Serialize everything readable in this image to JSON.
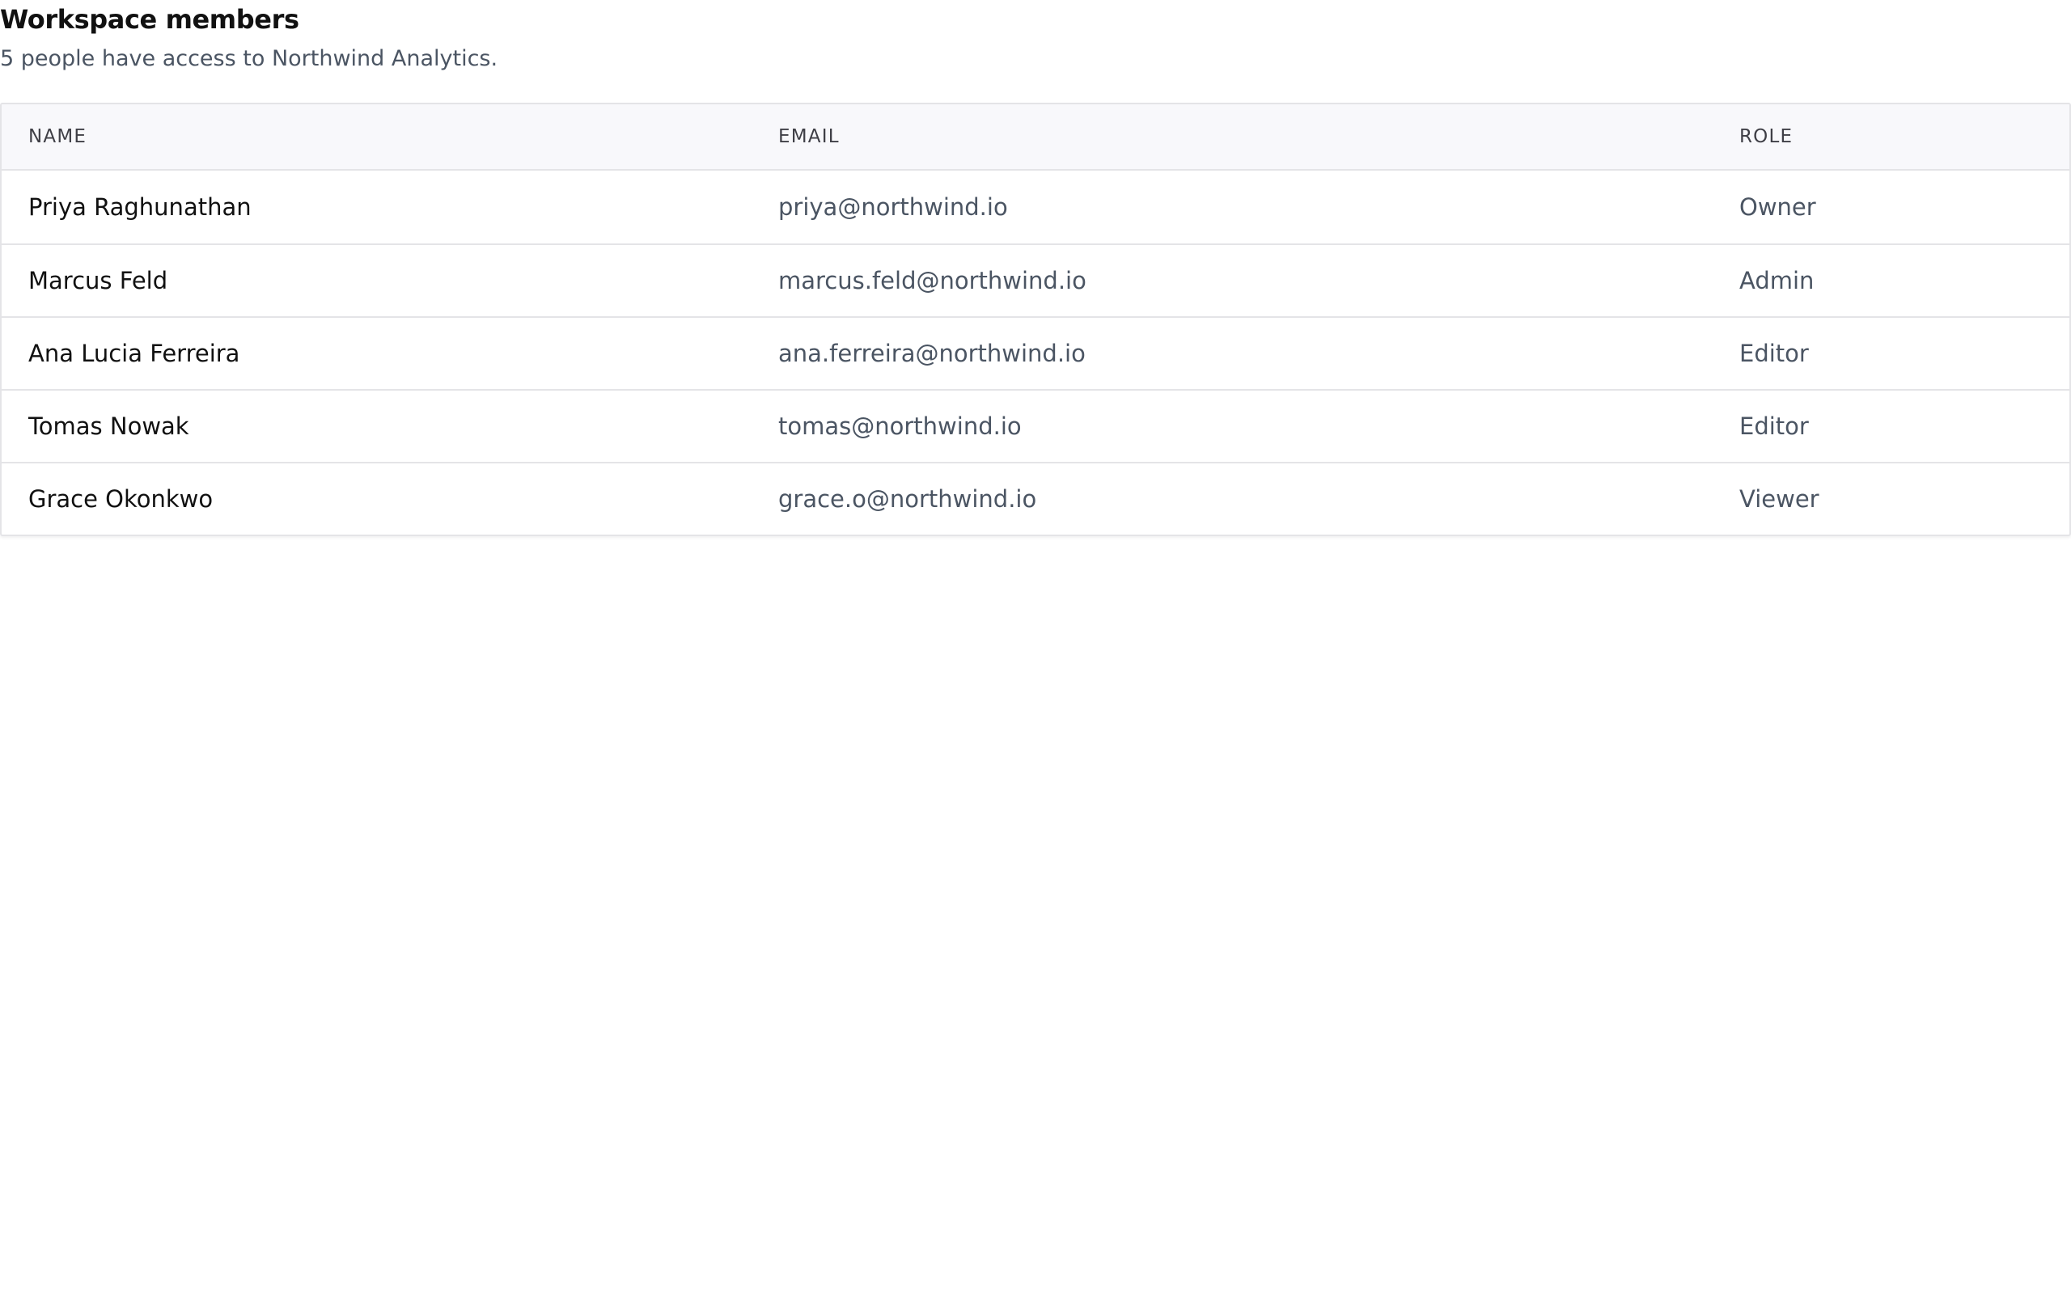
{
  "header": {
    "title": "Workspace members",
    "subtitle": "5 people have access to Northwind Analytics."
  },
  "table": {
    "columns": [
      "NAME",
      "EMAIL",
      "ROLE"
    ],
    "rows": [
      {
        "name": "Priya Raghunathan",
        "email": "priya@northwind.io",
        "role": "Owner"
      },
      {
        "name": "Marcus Feld",
        "email": "marcus.feld@northwind.io",
        "role": "Admin"
      },
      {
        "name": "Ana Lucia Ferreira",
        "email": "ana.ferreira@northwind.io",
        "role": "Editor"
      },
      {
        "name": "Tomas Nowak",
        "email": "tomas@northwind.io",
        "role": "Editor"
      },
      {
        "name": "Grace Okonkwo",
        "email": "grace.o@northwind.io",
        "role": "Viewer"
      }
    ]
  },
  "colors": {
    "border": "#e4e4e7",
    "header_bg": "#f8f8fb",
    "text_primary": "#111111",
    "text_secondary": "#4b5563"
  }
}
